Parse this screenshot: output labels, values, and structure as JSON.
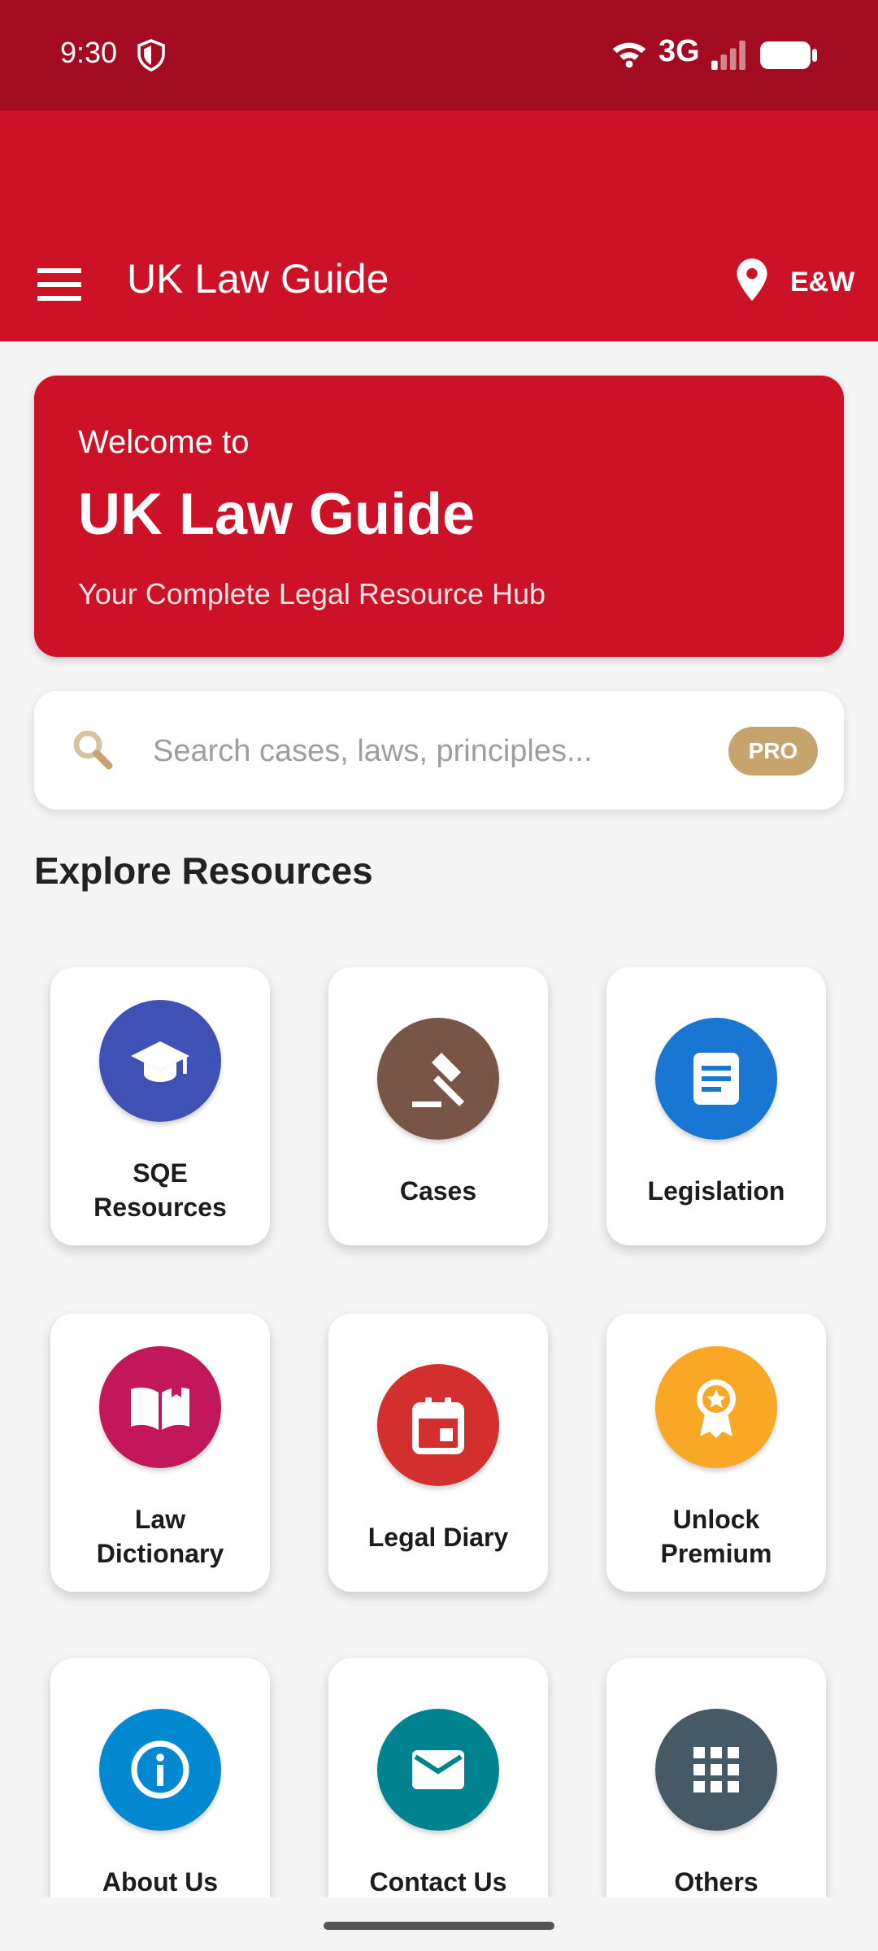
{
  "status_bar": {
    "time": "9:30",
    "network": "3G",
    "icons": [
      "shield-icon",
      "wifi-icon",
      "signal-icon",
      "battery-icon"
    ]
  },
  "app_bar": {
    "title": "UK Law Guide",
    "region": "E&W",
    "icons": [
      "menu-icon",
      "location-pin-icon"
    ]
  },
  "welcome": {
    "pre_title": "Welcome to",
    "title": "UK Law Guide",
    "subtitle": "Your Complete Legal Resource Hub"
  },
  "search": {
    "placeholder": "Search cases, laws, principles...",
    "badge": "PRO"
  },
  "section_title": "Explore Resources",
  "tiles": [
    {
      "label": "SQE Resources",
      "label_lines": [
        "SQE",
        "Resources"
      ],
      "icon": "graduation-cap-icon",
      "color": "#3f51b5"
    },
    {
      "label": "Cases",
      "icon": "gavel-icon",
      "color": "#795548"
    },
    {
      "label": "Legislation",
      "icon": "document-icon",
      "color": "#1976d2"
    },
    {
      "label": "Law Dictionary",
      "label_lines": [
        "Law",
        "Dictionary"
      ],
      "icon": "book-icon",
      "color": "#c2185b"
    },
    {
      "label": "Legal Diary",
      "icon": "calendar-icon",
      "color": "#d32f2f"
    },
    {
      "label": "Unlock Premium",
      "label_lines": [
        "Unlock",
        "Premium"
      ],
      "icon": "award-icon",
      "color": "#f9a825"
    },
    {
      "label": "About Us",
      "icon": "info-icon",
      "color": "#0288d1"
    },
    {
      "label": "Contact Us",
      "icon": "mail-icon",
      "color": "#00838f"
    },
    {
      "label": "Others",
      "icon": "grid-icon",
      "color": "#455a64"
    }
  ],
  "colors": {
    "status_bar": "#a30c20",
    "app_bar": "#cd1126",
    "welcome_card": "#cd1126",
    "pro_badge": "#c7a46e",
    "background": "#f4f4f4"
  }
}
